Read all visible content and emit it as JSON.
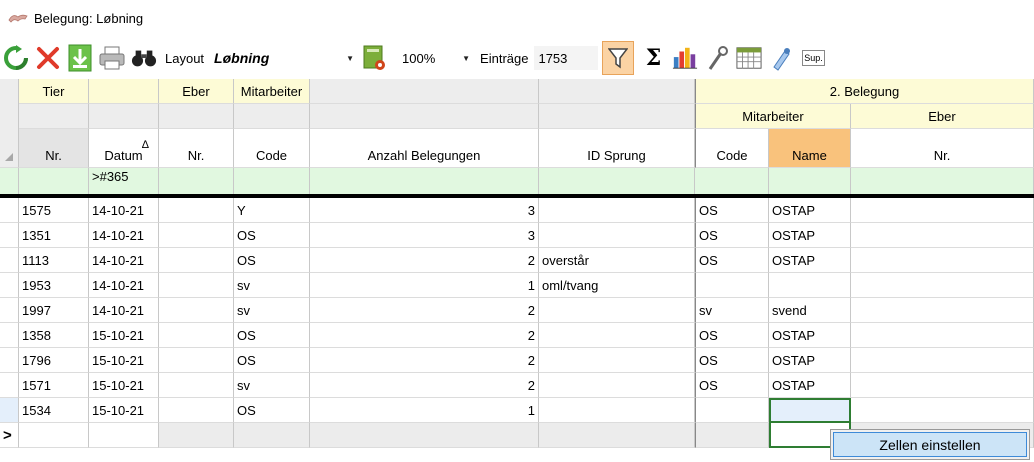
{
  "window": {
    "title": "Belegung: Løbning"
  },
  "toolbar": {
    "icons": [
      "refresh-icon",
      "delete-icon",
      "export-icon",
      "print-icon",
      "binoculars-icon"
    ],
    "layout_label": "Layout",
    "layout_value": "Løbning",
    "zoom_value": "100%",
    "entries_label": "Einträge",
    "entries_value": "1753",
    "sigma": "Σ",
    "sup_label": "Sup."
  },
  "grid": {
    "group_headers": {
      "tier": "Tier",
      "eber": "Eber",
      "mitarbeiter": "Mitarbeiter",
      "belegung2": "2. Belegung",
      "belegung2_mitarbeiter": "Mitarbeiter",
      "belegung2_eber": "Eber"
    },
    "columns": {
      "nr": "Nr.",
      "datum": "Datum",
      "eber_nr": "Nr.",
      "code": "Code",
      "anzahl": "Anzahl Belegungen",
      "id_sprung": "ID Sprung",
      "b2_code": "Code",
      "b2_name": "Name",
      "b2_eber_nr": "Nr."
    },
    "sort_indicator": "∆",
    "filter": {
      "datum": ">#365"
    },
    "rows": [
      {
        "nr": "1575",
        "datum": "14-10-21",
        "eber_nr": "",
        "code": "Y",
        "anzahl": "3",
        "id_sprung": "",
        "b2_code": "OS",
        "b2_name": "OSTAP",
        "b2_eber_nr": ""
      },
      {
        "nr": "1351",
        "datum": "14-10-21",
        "eber_nr": "",
        "code": "OS",
        "anzahl": "3",
        "id_sprung": "",
        "b2_code": "OS",
        "b2_name": "OSTAP",
        "b2_eber_nr": ""
      },
      {
        "nr": "1113",
        "datum": "14-10-21",
        "eber_nr": "",
        "code": "OS",
        "anzahl": "2",
        "id_sprung": "overstår",
        "b2_code": "OS",
        "b2_name": "OSTAP",
        "b2_eber_nr": ""
      },
      {
        "nr": "1953",
        "datum": "14-10-21",
        "eber_nr": "",
        "code": "sv",
        "anzahl": "1",
        "id_sprung": "oml/tvang",
        "b2_code": "",
        "b2_name": "",
        "b2_eber_nr": ""
      },
      {
        "nr": "1997",
        "datum": "14-10-21",
        "eber_nr": "",
        "code": "sv",
        "anzahl": "2",
        "id_sprung": "",
        "b2_code": "sv",
        "b2_name": "svend",
        "b2_eber_nr": ""
      },
      {
        "nr": "1358",
        "datum": "15-10-21",
        "eber_nr": "",
        "code": "OS",
        "anzahl": "2",
        "id_sprung": "",
        "b2_code": "OS",
        "b2_name": "OSTAP",
        "b2_eber_nr": ""
      },
      {
        "nr": "1796",
        "datum": "15-10-21",
        "eber_nr": "",
        "code": "OS",
        "anzahl": "2",
        "id_sprung": "",
        "b2_code": "OS",
        "b2_name": "OSTAP",
        "b2_eber_nr": ""
      },
      {
        "nr": "1571",
        "datum": "15-10-21",
        "eber_nr": "",
        "code": "sv",
        "anzahl": "2",
        "id_sprung": "",
        "b2_code": "OS",
        "b2_name": "OSTAP",
        "b2_eber_nr": ""
      },
      {
        "nr": "1534",
        "datum": "15-10-21",
        "eber_nr": "",
        "code": "OS",
        "anzahl": "1",
        "id_sprung": "",
        "b2_code": "",
        "b2_name": "",
        "b2_eber_nr": ""
      }
    ],
    "new_row_marker": ">"
  },
  "context_menu": {
    "item": "Zellen einstellen"
  },
  "colors": {
    "header_yellow": "#fdfbd6",
    "header_gray": "#ededed",
    "filter_green": "#e1f8e0",
    "name_header_orange": "#f9c27c",
    "active_cell_border": "#2e7d32"
  }
}
